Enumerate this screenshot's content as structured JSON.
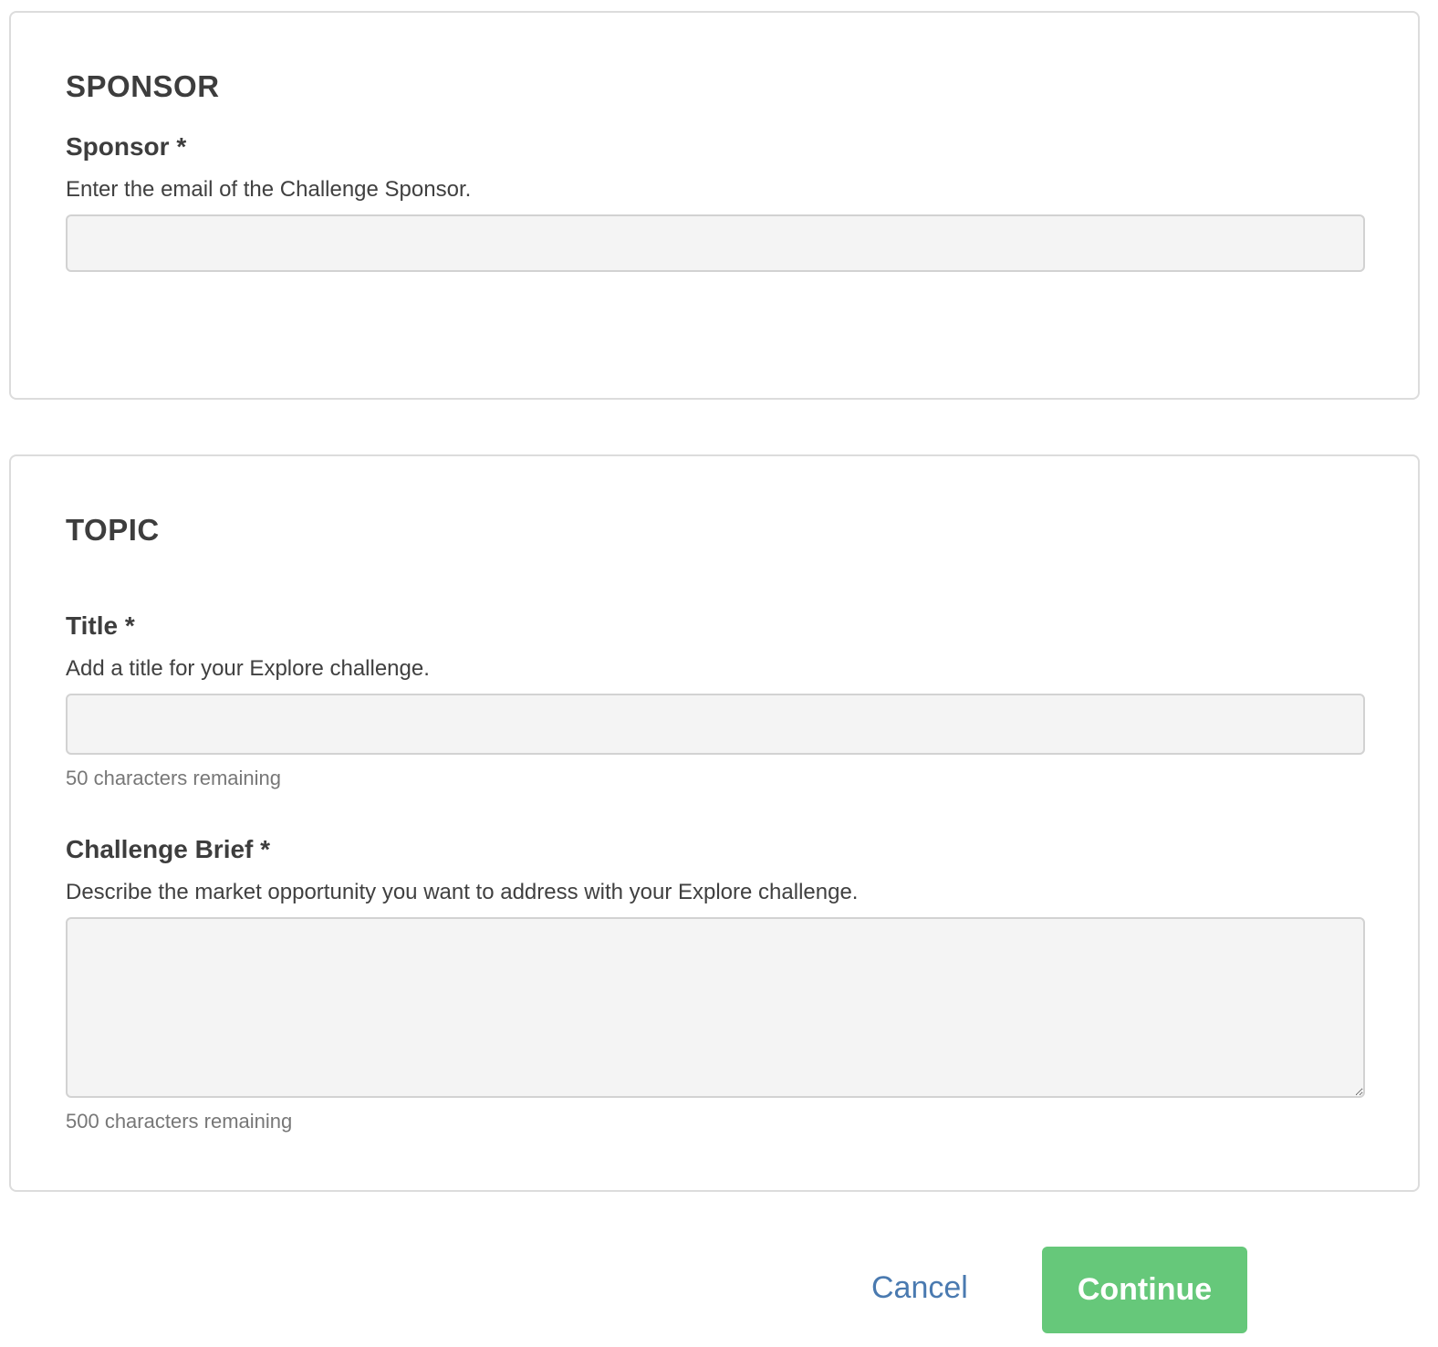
{
  "sponsor_section": {
    "title": "SPONSOR",
    "field": {
      "label": "Sponsor *",
      "help": "Enter the email of the Challenge Sponsor.",
      "value": ""
    }
  },
  "topic_section": {
    "title": "TOPIC",
    "title_field": {
      "label": "Title *",
      "help": "Add a title for your Explore challenge.",
      "value": "",
      "counter": "50 characters remaining"
    },
    "brief_field": {
      "label": "Challenge Brief *",
      "help": "Describe the market opportunity you want to address with your Explore challenge.",
      "value": "",
      "counter": "500 characters remaining"
    }
  },
  "actions": {
    "cancel_label": "Cancel",
    "continue_label": "Continue"
  },
  "colors": {
    "accent_green": "#66c87a",
    "link_blue": "#4a7ab0",
    "input_bg": "#f4f4f4",
    "border": "#dcdcdc"
  }
}
